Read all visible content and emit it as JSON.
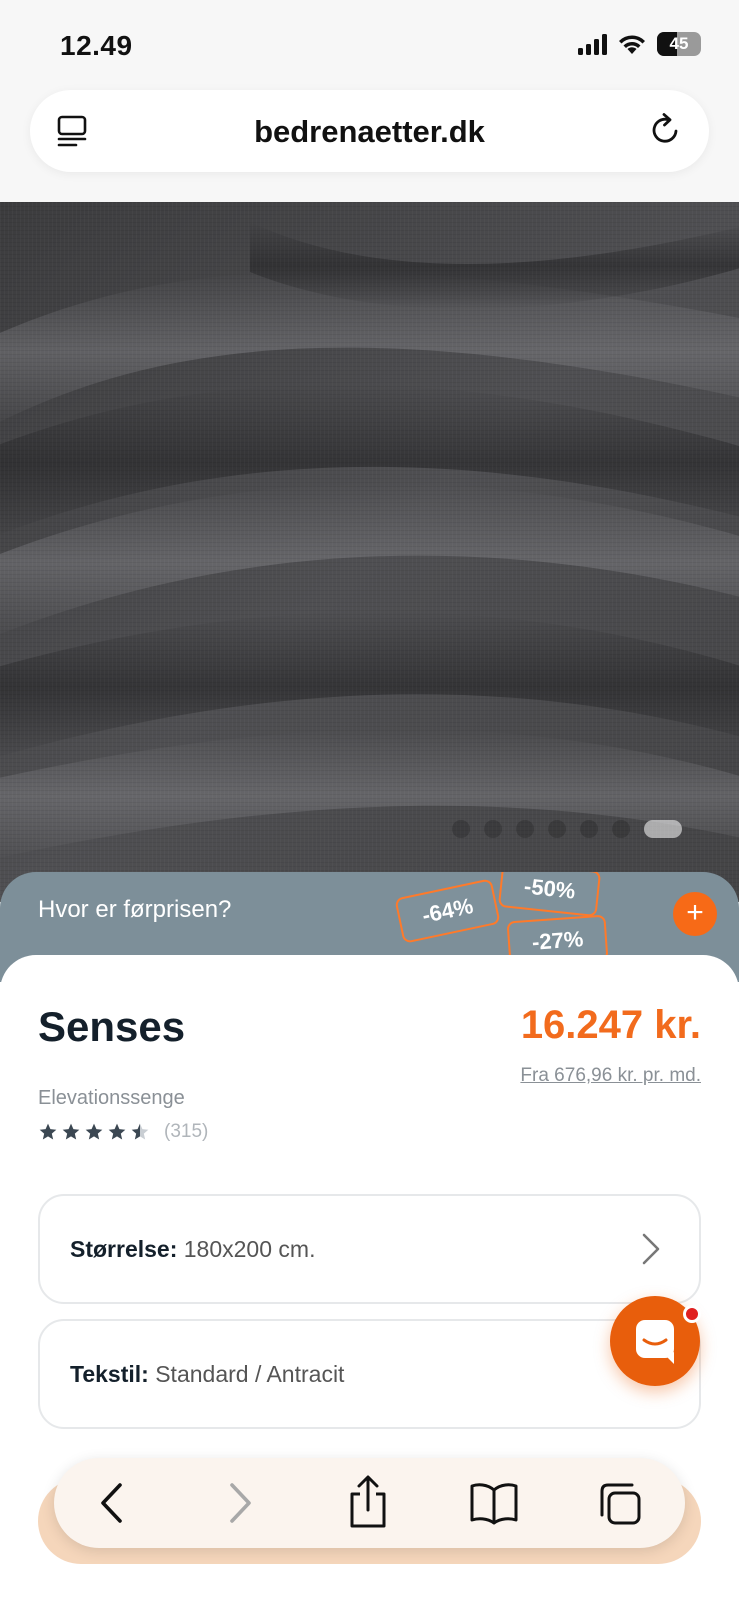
{
  "status_bar": {
    "time": "12.49",
    "battery": "45",
    "battery_fraction": 0.45
  },
  "browser": {
    "url": "bedrenaetter.dk"
  },
  "gallery": {
    "slide_count": 7,
    "active_index": 6
  },
  "promo": {
    "text": "Hvor er førprisen?",
    "tags": [
      "-64%",
      "-50%",
      "-27%"
    ]
  },
  "product": {
    "name": "Senses",
    "price": "16.247 kr.",
    "finance": "Fra 676,96 kr. pr. md.",
    "category": "Elevationssenge",
    "rating": 4.5,
    "review_count": "(315)"
  },
  "options": [
    {
      "label": "Størrelse:",
      "value": "180x200 cm."
    },
    {
      "label": "Tekstil:",
      "value": "Standard / Antracit"
    }
  ],
  "colors": {
    "accent": "#f26b1d",
    "promo_bg": "#7d8f99",
    "heading": "#14202b"
  }
}
